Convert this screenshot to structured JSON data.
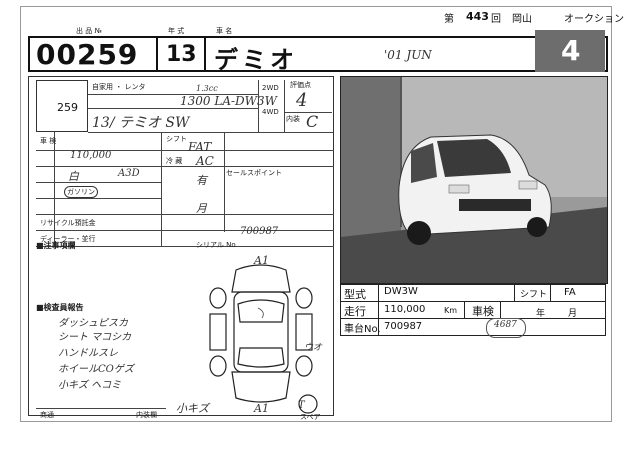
{
  "header": {
    "kai": "第",
    "auction_no": "443",
    "kai_suffix": "回",
    "location": "岡山",
    "org": "オークション"
  },
  "top_labels": {
    "lot_label": "出 品 №",
    "year_label": "年 式",
    "name_label": "車 名"
  },
  "lot_number": "00259",
  "model_year": "13",
  "car_name": "デミオ",
  "handwritten_year": "'01 JUN",
  "grade_score": "4",
  "left_form": {
    "row_id": "259",
    "displacement": "1.3cc",
    "model_code_hand": "1300 LA-DW3W",
    "model_line_hand": "13/ テミオ SW",
    "shift_hand": "FAT",
    "ac_hand": "AC",
    "fuel_label": "ガソリン",
    "km_hand": "110,000",
    "mark_yes": "有",
    "mark_moon": "月",
    "chassis_hand": "700987",
    "score_hand": "4",
    "interior_hand": "C",
    "color_hand": "白",
    "color_code_hand": "A3D",
    "chuui_label": "■注事項欄",
    "inspect_label": "■検査員報告",
    "notes": [
      "ダッシュピスカ",
      "シート マコシカ",
      "ハンドルスレ",
      "ホイールCOゲズ",
      "小キズ ヘコミ"
    ],
    "recycle_label": "リサイクル預託金",
    "dealer_label": "ディーラー・並行",
    "serial_label": "シリアル No",
    "car_label_A1_top": "A1",
    "car_label_A1_bottom": "A1",
    "car_label_spare": "スペア",
    "car_label_T": "T",
    "diag_note": "ウオ"
  },
  "spec_table": {
    "model_label": "型式",
    "model_value": "DW3W",
    "shift_label": "シフト",
    "shift_value": "FA",
    "mileage_label": "走行",
    "mileage_value": "110,000",
    "mileage_unit": "Km",
    "inspection_label": "車検",
    "year_unit": "年",
    "month_unit": "月",
    "chassis_label": "車台No.",
    "chassis_value": "700987",
    "hand_note": "4687"
  },
  "footer": {
    "left_label": "商通",
    "right_label": "内装欄",
    "bottom_hand": "小キズ"
  },
  "colors": {
    "ink": "#111111",
    "photo_bg": "#8a8a8a",
    "grade_bg": "#6d6d6d"
  }
}
